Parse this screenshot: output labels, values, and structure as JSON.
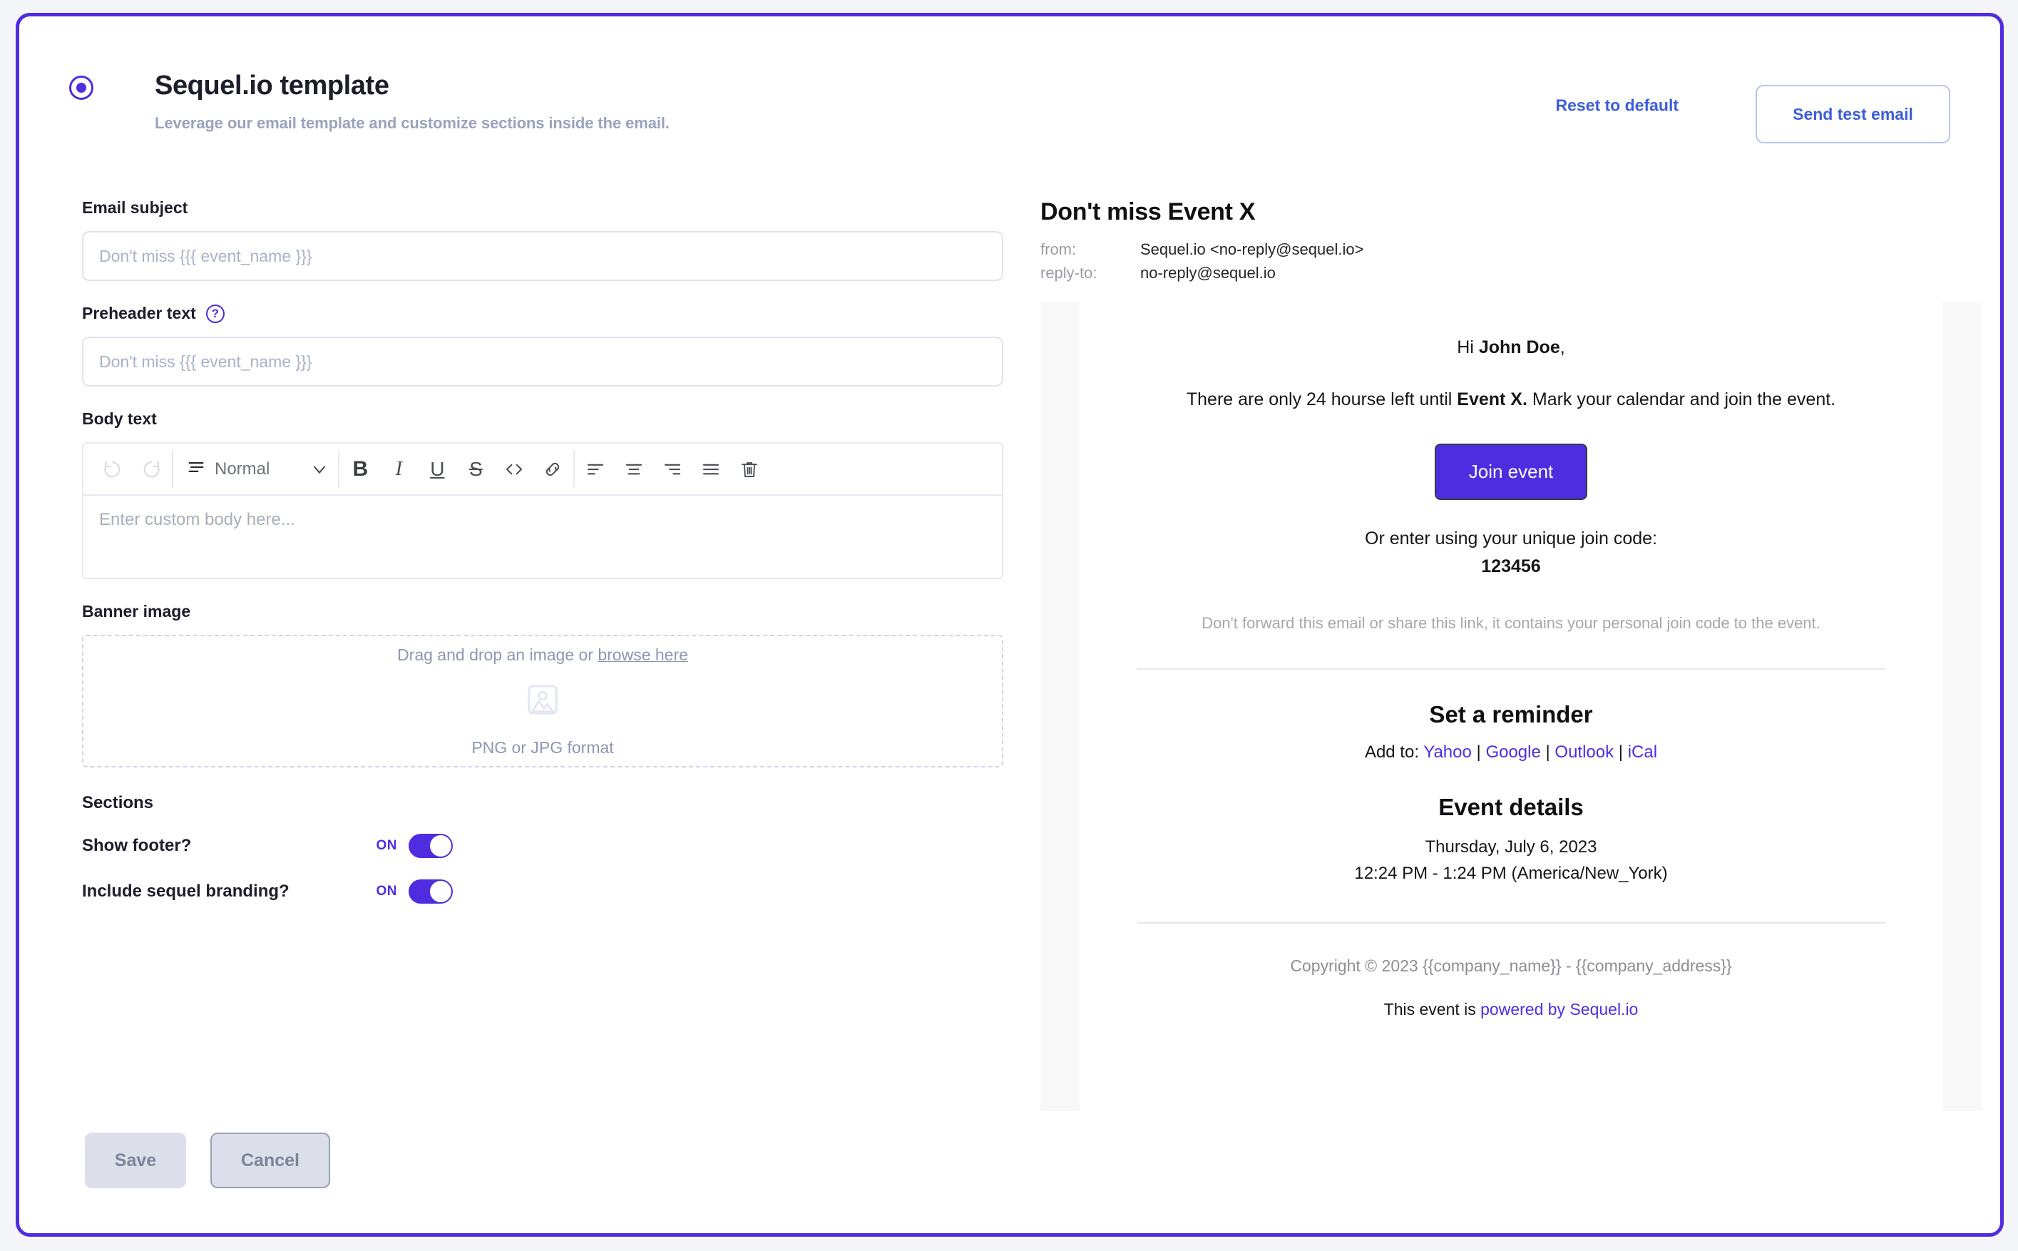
{
  "header": {
    "radio_selected": true,
    "title": "Sequel.io template",
    "subtitle": "Leverage our email template and customize sections inside the email.",
    "reset_label": "Reset to default",
    "send_test_label": "Send test email"
  },
  "form": {
    "email_subject_label": "Email subject",
    "email_subject_value": "",
    "email_subject_placeholder": "Don't miss {{{ event_name }}}",
    "preheader_label": "Preheader text",
    "preheader_help": "?",
    "preheader_value": "",
    "preheader_placeholder": "Don't miss {{{ event_name }}}",
    "body_label": "Body text",
    "body_placeholder": "Enter custom body here...",
    "toolbar": {
      "undo": "undo-icon",
      "redo": "redo-icon",
      "format_value": "Normal",
      "format_chevron": "chevron-down-icon",
      "bold": "B",
      "italic": "I",
      "underline": "U",
      "strikethrough": "S",
      "code": "<>",
      "link": "link-icon",
      "align_left": "align-left-icon",
      "align_center": "align-center-icon",
      "align_right": "align-right-icon",
      "align_justify": "align-justify-icon",
      "trash": "trash-icon"
    },
    "banner_label": "Banner image",
    "dropzone_text": "Drag and drop an image or ",
    "dropzone_browse": "browse here",
    "dropzone_format": "PNG or JPG format",
    "sections_title": "Sections",
    "toggles": [
      {
        "label": "Show footer?",
        "state": "ON",
        "on": true
      },
      {
        "label": "Include sequel branding?",
        "state": "ON",
        "on": true
      }
    ],
    "save_label": "Save",
    "cancel_label": "Cancel"
  },
  "preview": {
    "subject": "Don't miss Event X",
    "from_key": "from:",
    "from_value": "Sequel.io <no-reply@sequel.io>",
    "replyto_key": "reply-to:",
    "replyto_value": "no-reply@sequel.io",
    "greeting_prefix": "Hi ",
    "greeting_name": "John Doe",
    "greeting_suffix": ",",
    "body_part1": "There are only 24 hourse left until ",
    "body_bold": "Event X.",
    "body_part2": " Mark your calendar and join the event.",
    "join_button": "Join event",
    "joincode_label": "Or enter using your unique join code:",
    "joincode": "123456",
    "disclaimer": "Don't forward this email or share this link, it contains your personal join code to the event.",
    "reminder_title": "Set a reminder",
    "addto_label": "Add to:",
    "addto_links": [
      "Yahoo",
      "Google",
      "Outlook",
      "iCal"
    ],
    "addto_separator": "|",
    "details_title": "Event details",
    "details_date": "Thursday, July 6, 2023",
    "details_time": "12:24 PM - 1:24 PM (America/New_York)",
    "copyright": "Copyright © 2023 {{company_name}} - {{company_address}}",
    "powered_prefix": "This event is ",
    "powered_link": "powered by Sequel.io"
  },
  "colors": {
    "brand_purple": "#4f2ce0",
    "link_blue": "#3c5ddb",
    "email_button": "#4c2ee0",
    "page_bg": "#f4f5f8"
  }
}
